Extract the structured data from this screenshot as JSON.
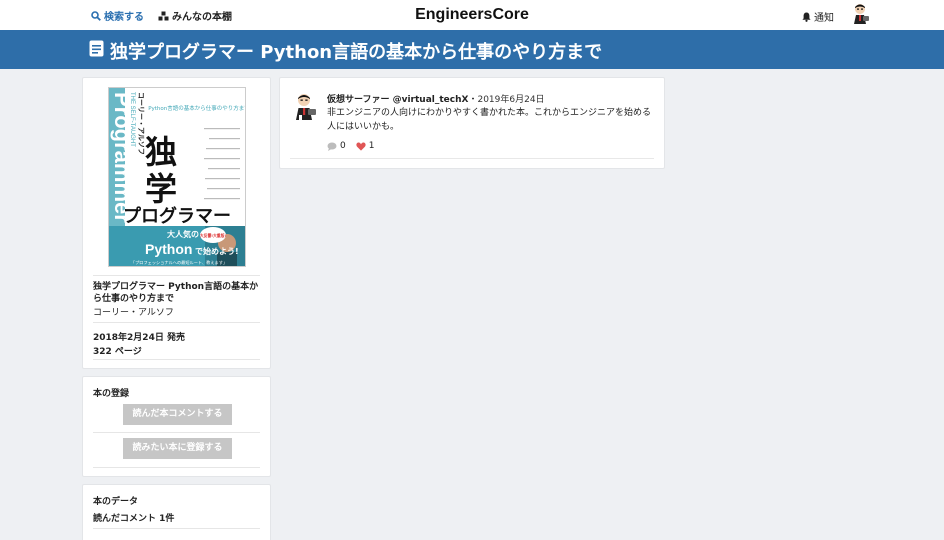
{
  "nav": {
    "search_label": "検索する",
    "shelf_label": "みんなの本棚",
    "brand": "EngineersCore",
    "notify_label": "通知"
  },
  "page": {
    "title": "独学プログラマー Python言語の基本から仕事のやり方まで"
  },
  "book": {
    "title": "独学プログラマー Python言語の基本から仕事のやり方まで",
    "author": "コーリー・アルソフ",
    "release": "2018年2月24日 発売",
    "pages": "322 ページ",
    "cover": {
      "subtitle": "Python言語の基本から仕事のやり方まで",
      "main_kanji_1": "独",
      "main_kanji_2": "学",
      "main_kana": "プログラマー",
      "side_word": "Programmer",
      "series": "THE SELF-TAUGHT",
      "author_vertical": "コーリー・アルソフ",
      "band_text_1": "大人気の",
      "band_text_2": "Python",
      "band_text_3": "で始めよう!",
      "band_badge": "大反響!大重版!",
      "band_caption": "「プロフェッショナルへの最短ルート、教えます」",
      "colors": {
        "teal": "#45a9b8",
        "band": "#3a9bb0"
      }
    }
  },
  "registration": {
    "heading": "本の登録",
    "read_button": "読んだ本コメントする",
    "want_button": "読みたい本に登録する"
  },
  "book_data": {
    "heading": "本のデータ",
    "read_comments": "読んだコメント 1件"
  },
  "review": {
    "user": "仮想サーファー @virtual_techX",
    "separator": "・",
    "date": "2019年6月24日",
    "text": "非エンジニアの人向けにわかりやすく書かれた本。これからエンジニアを始める人にはいいかも。",
    "comments": "0",
    "likes": "1"
  },
  "colors": {
    "header_blue": "#2e6ea9",
    "link_blue": "#2a6fb0",
    "heart": "#e05555",
    "button_gray": "#c6c6c6"
  }
}
